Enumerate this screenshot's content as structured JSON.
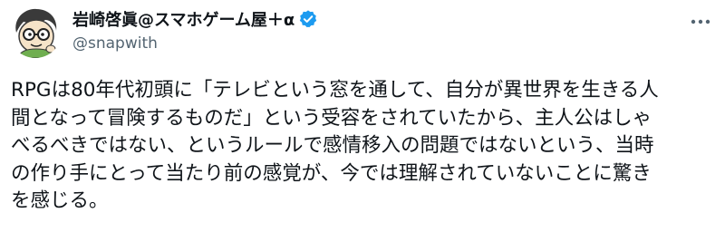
{
  "post": {
    "author": {
      "display_name": "岩崎啓眞@スマホゲーム屋＋α",
      "handle": "@snapwith",
      "avatar_icon": "avatar-cartoon-icon",
      "verified_icon": "verified-badge-icon",
      "verified_color": "#1d9bf0"
    },
    "more_icon": "more-dots-icon",
    "text_lines": [
      "RPGは80年代初頭に「テレビという窓を通して、自分が異世界を生きる人",
      "間となって冒険するものだ」という受容をされていたから、主人公はしゃ",
      "べるべきではない、というルールで感情移入の問題ではないという、当時",
      "の作り手にとって当たり前の感覚が、今では理解されていないことに驚き",
      "を感じる。"
    ]
  }
}
